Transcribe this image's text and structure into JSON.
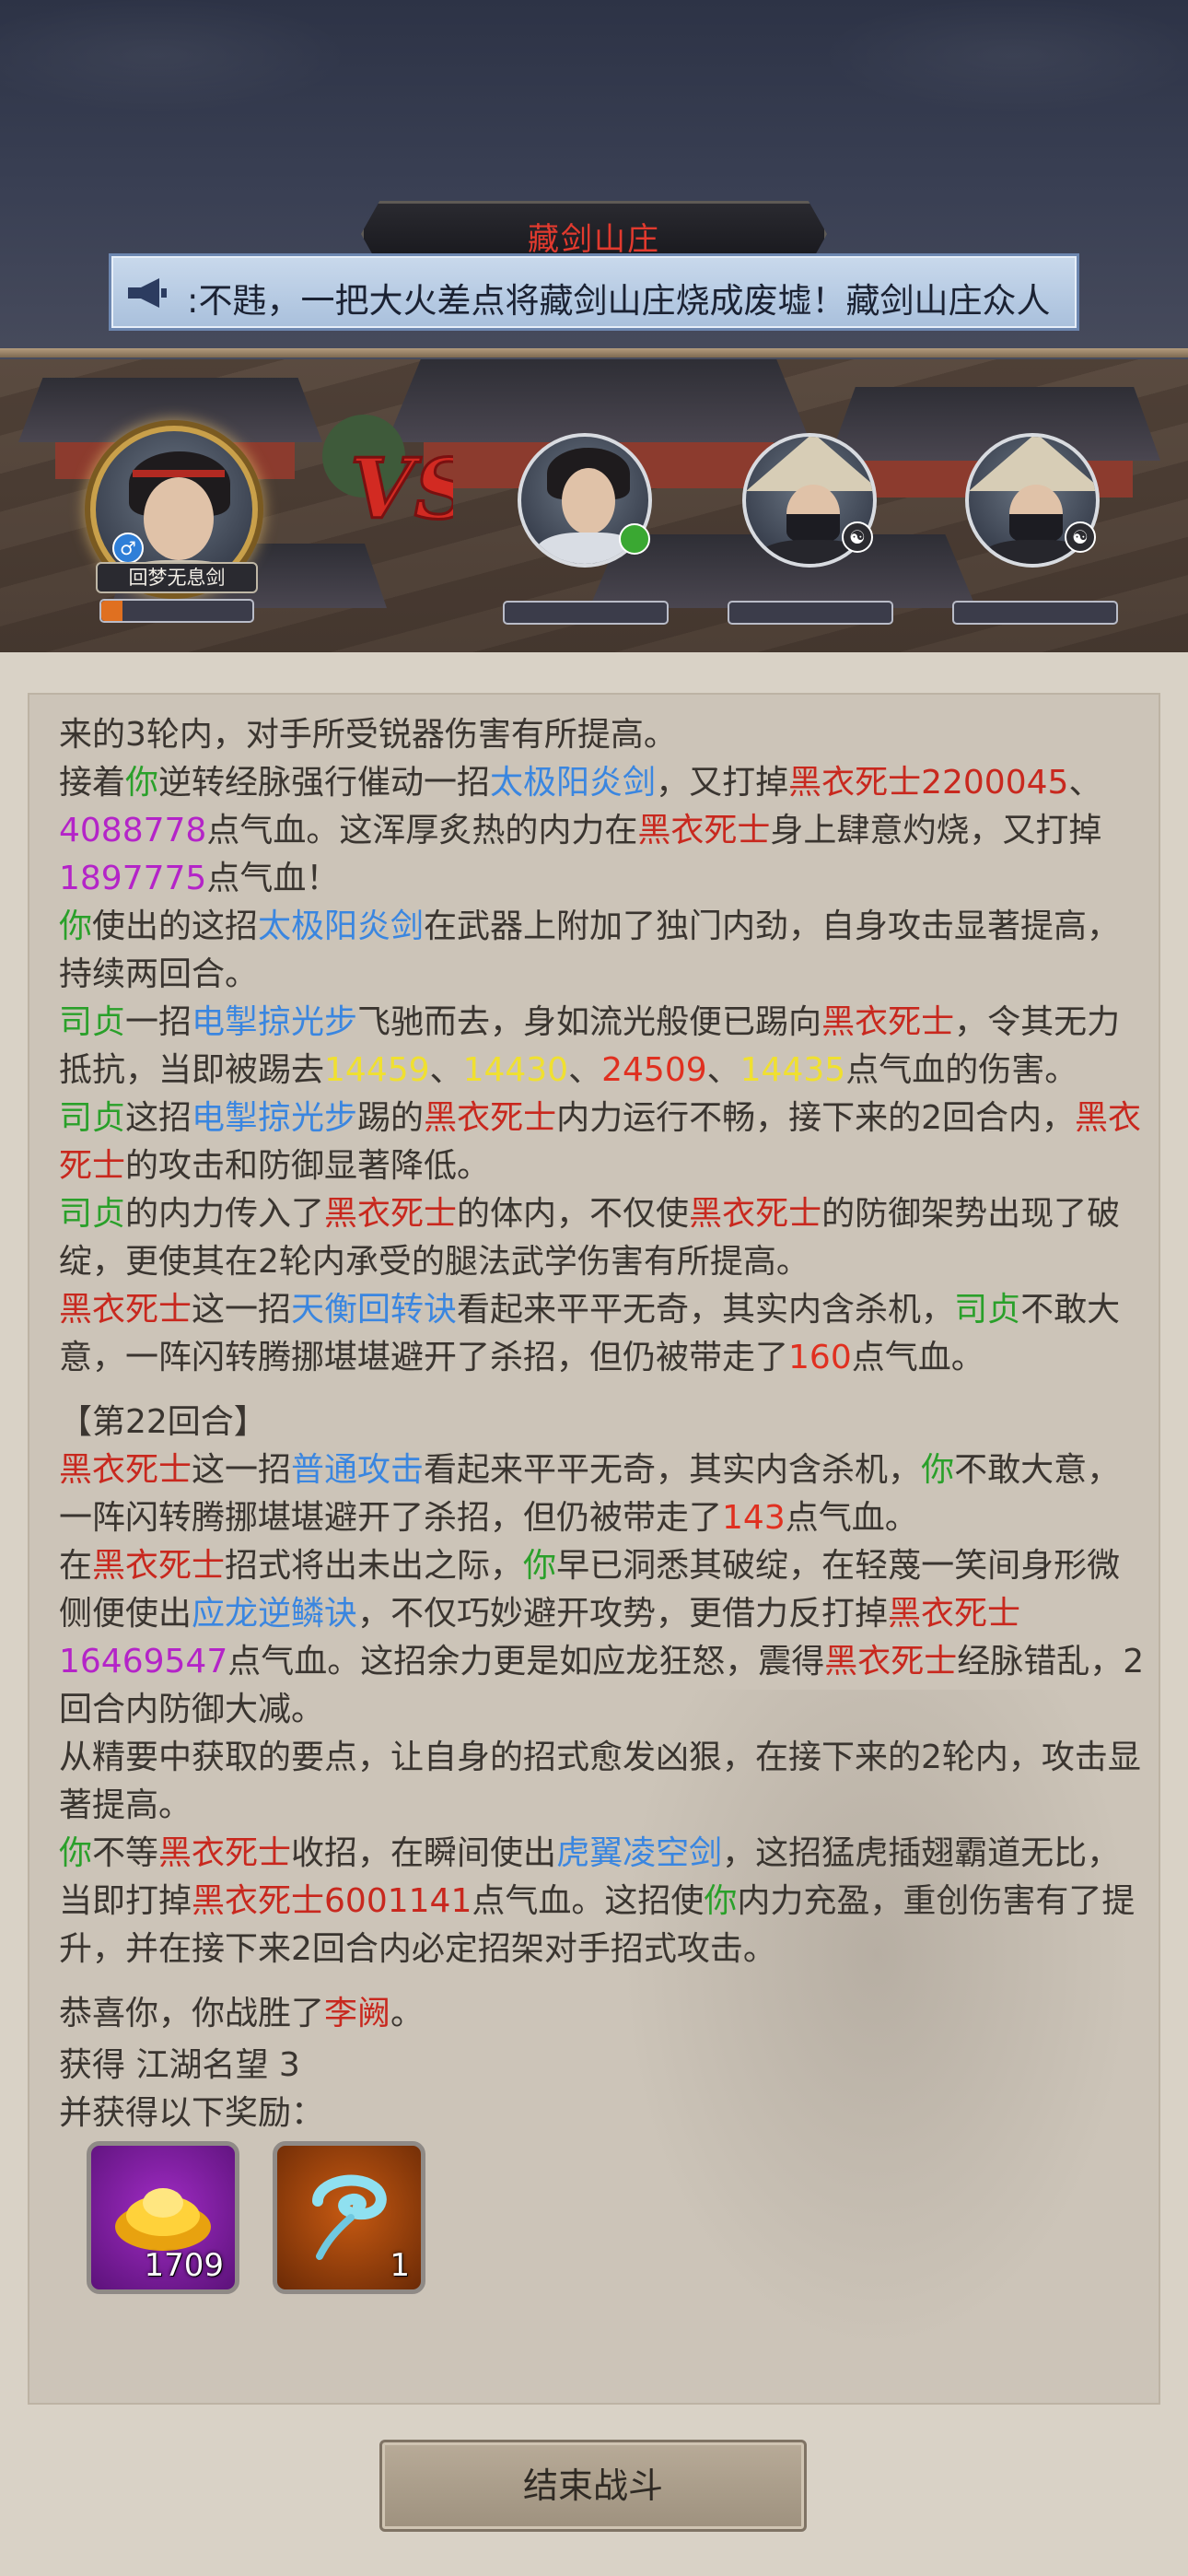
{
  "header": {
    "location_title": "藏剑山庄",
    "announcement": ":不韪，一把大火差点将藏剑山庄烧成废墟！藏剑山庄众人"
  },
  "battle": {
    "player_name": "回梦无息剑",
    "player_gender_badge": "♂",
    "vs_label": "VS",
    "enemy_badges": [
      "",
      "☯",
      "☯"
    ],
    "colors": {
      "red": "#c8281e",
      "green": "#2aa02a",
      "blue": "#3a86e0",
      "purple": "#b424c8",
      "yellow": "#f0e030"
    }
  },
  "log": {
    "lines": [
      [
        {
          "t": "来的3轮内，对手所受锐器伤害有所提高。"
        }
      ],
      [
        {
          "t": "接着"
        },
        {
          "t": "你",
          "c": "green"
        },
        {
          "t": "逆转经脉强行催动一招"
        },
        {
          "t": "太极阳炎剑",
          "c": "blue"
        },
        {
          "t": "，又打掉"
        },
        {
          "t": "黑衣死士",
          "c": "red"
        },
        {
          "t": "2200045",
          "c": "red"
        },
        {
          "t": "、"
        },
        {
          "t": "4088778",
          "c": "purple"
        },
        {
          "t": "点气血。这浑厚炙热的内力在"
        },
        {
          "t": "黑衣死士",
          "c": "red"
        },
        {
          "t": "身上肆意灼烧，又打掉"
        },
        {
          "t": "1897775",
          "c": "purple"
        },
        {
          "t": "点气血！"
        }
      ],
      [
        {
          "t": "你",
          "c": "green"
        },
        {
          "t": "使出的这招"
        },
        {
          "t": "太极阳炎剑",
          "c": "blue"
        },
        {
          "t": "在武器上附加了独门内劲，自身攻击显著提高，持续两回合。"
        }
      ],
      [
        {
          "t": "司贞",
          "c": "green"
        },
        {
          "t": "一招"
        },
        {
          "t": "电掣掠光步",
          "c": "blue"
        },
        {
          "t": "飞驰而去，身如流光般便已踢向"
        },
        {
          "t": "黑衣死士",
          "c": "red"
        },
        {
          "t": "，令其无力抵抗，当即被踢去"
        },
        {
          "t": "14459",
          "c": "yellow"
        },
        {
          "t": "、"
        },
        {
          "t": "14430",
          "c": "yellow"
        },
        {
          "t": "、"
        },
        {
          "t": "24509",
          "c": "rredd"
        },
        {
          "t": "、"
        },
        {
          "t": "14435",
          "c": "yellow"
        },
        {
          "t": "点气血的伤害。"
        }
      ],
      [
        {
          "t": "司贞",
          "c": "green"
        },
        {
          "t": "这招"
        },
        {
          "t": "电掣掠光步",
          "c": "blue"
        },
        {
          "t": "踢的"
        },
        {
          "t": "黑衣死士",
          "c": "red"
        },
        {
          "t": "内力运行不畅，接下来的2回合内，"
        },
        {
          "t": "黑衣死士",
          "c": "red"
        },
        {
          "t": "的攻击和防御显著降低。"
        }
      ],
      [
        {
          "t": "司贞",
          "c": "green"
        },
        {
          "t": "的内力传入了"
        },
        {
          "t": "黑衣死士",
          "c": "red"
        },
        {
          "t": "的体内，不仅使"
        },
        {
          "t": "黑衣死士",
          "c": "red"
        },
        {
          "t": "的防御架势出现了破绽，更使其在2轮内承受的腿法武学伤害有所提高。"
        }
      ],
      [
        {
          "t": "黑衣死士",
          "c": "red"
        },
        {
          "t": "这一招"
        },
        {
          "t": "天衡回转诀",
          "c": "blue"
        },
        {
          "t": "看起来平平无奇，其实内含杀机，"
        },
        {
          "t": "司贞",
          "c": "green"
        },
        {
          "t": "不敢大意，一阵闪转腾挪堪堪避开了杀招，但仍被带走了"
        },
        {
          "t": "160",
          "c": "rredd"
        },
        {
          "t": "点气血。"
        }
      ],
      [
        {
          "gap": true
        }
      ],
      [
        {
          "t": "【第22回合】"
        }
      ],
      [
        {
          "t": "黑衣死士",
          "c": "red"
        },
        {
          "t": "这一招"
        },
        {
          "t": "普通攻击",
          "c": "blue"
        },
        {
          "t": "看起来平平无奇，其实内含杀机，"
        },
        {
          "t": "你",
          "c": "green"
        },
        {
          "t": "不敢大意，一阵闪转腾挪堪堪避开了杀招，但仍被带走了"
        },
        {
          "t": "143",
          "c": "rredd"
        },
        {
          "t": "点气血。"
        }
      ],
      [
        {
          "t": "在"
        },
        {
          "t": "黑衣死士",
          "c": "red"
        },
        {
          "t": "招式将出未出之际，"
        },
        {
          "t": "你",
          "c": "green"
        },
        {
          "t": "早已洞悉其破绽，在轻蔑一笑间身形微侧便使出"
        },
        {
          "t": "应龙逆鳞诀",
          "c": "blue"
        },
        {
          "t": "，不仅巧妙避开攻势，更借力反打掉"
        },
        {
          "t": "黑衣死士",
          "c": "red"
        },
        {
          "t": "16469547",
          "c": "purple"
        },
        {
          "t": "点气血。这招余力更是如应龙狂怒，震得"
        },
        {
          "t": "黑衣死士",
          "c": "red"
        },
        {
          "t": "经脉错乱，2回合内防御大减。"
        }
      ],
      [
        {
          "t": "从精要中获取的要点，让自身的招式愈发凶狠，在接下来的2轮内，攻击显著提高。"
        }
      ],
      [
        {
          "t": "你",
          "c": "green"
        },
        {
          "t": "不等"
        },
        {
          "t": "黑衣死士",
          "c": "red"
        },
        {
          "t": "收招，在瞬间使出"
        },
        {
          "t": "虎翼凌空剑",
          "c": "blue"
        },
        {
          "t": "，这招猛虎插翅霸道无比，当即打掉"
        },
        {
          "t": "黑衣死士",
          "c": "red"
        },
        {
          "t": "6001141",
          "c": "red"
        },
        {
          "t": "点气血。这招使"
        },
        {
          "t": "你",
          "c": "green"
        },
        {
          "t": "内力充盈，重创伤害有了提升，并在接下来2回合内必定招架对手招式攻击。"
        }
      ],
      [
        {
          "gap": true
        }
      ],
      [
        {
          "t": "恭喜你，你战胜了"
        },
        {
          "t": "李阙",
          "c": "red"
        },
        {
          "t": "。"
        }
      ],
      [
        {
          "gap": true,
          "small": true
        }
      ],
      [
        {
          "t": "获得 江湖名望 3"
        }
      ],
      [
        {
          "t": "并获得以下奖励："
        }
      ]
    ]
  },
  "rewards": [
    {
      "icon": "gold-ingot-icon",
      "count": "1709"
    },
    {
      "icon": "blue-cloud-icon",
      "count": "1"
    }
  ],
  "footer": {
    "end_button_label": "结束战斗"
  }
}
